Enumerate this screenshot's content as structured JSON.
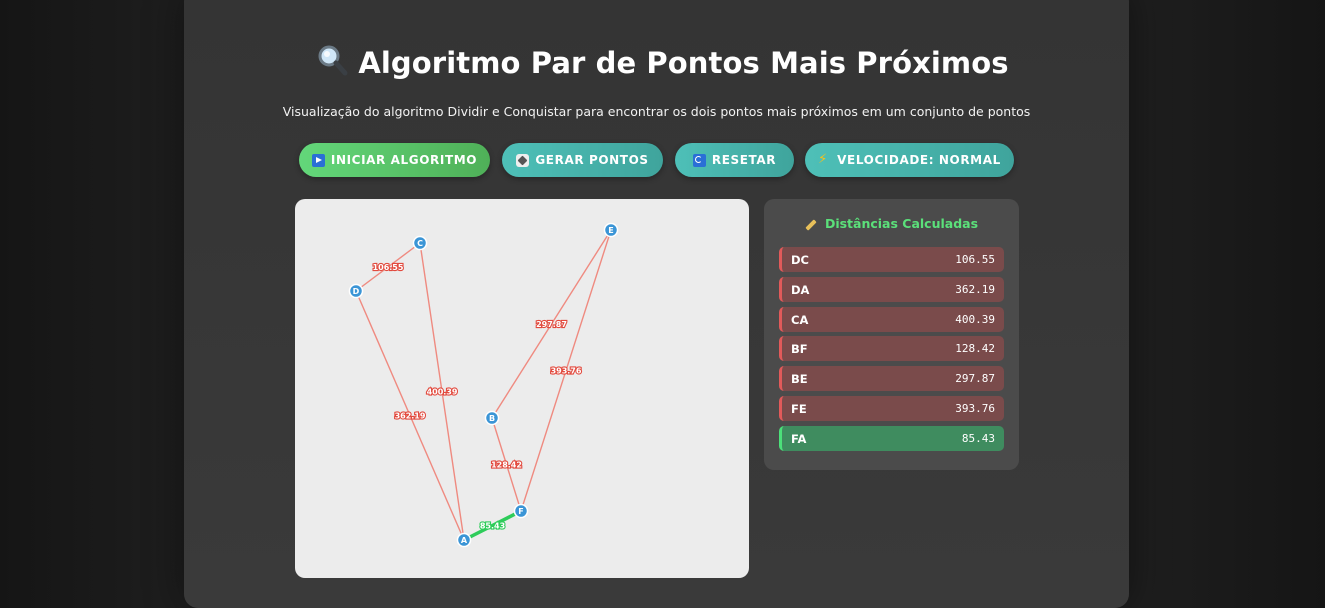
{
  "header": {
    "title": "Algoritmo Par de Pontos Mais Próximos",
    "subtitle": "Visualização do algoritmo Dividir e Conquistar para encontrar os dois pontos mais próximos em um conjunto de pontos"
  },
  "toolbar": {
    "start_label": "INICIAR ALGORITMO",
    "generate_label": "GERAR PONTOS",
    "reset_label": "RESETAR",
    "speed_label": "VELOCIDADE: NORMAL"
  },
  "canvas": {
    "points": [
      {
        "label": "A"
      },
      {
        "label": "B"
      },
      {
        "label": "C"
      },
      {
        "label": "D"
      },
      {
        "label": "E"
      },
      {
        "label": "F"
      }
    ],
    "edges": [
      {
        "from": "D",
        "to": "C",
        "label": "106.55",
        "best": false
      },
      {
        "from": "D",
        "to": "A",
        "label": "362.19",
        "best": false
      },
      {
        "from": "C",
        "to": "A",
        "label": "400.39",
        "best": false
      },
      {
        "from": "B",
        "to": "F",
        "label": "128.42",
        "best": false
      },
      {
        "from": "B",
        "to": "E",
        "label": "297.87",
        "best": false
      },
      {
        "from": "F",
        "to": "E",
        "label": "393.76",
        "best": false
      },
      {
        "from": "F",
        "to": "A",
        "label": "85.43",
        "best": true
      }
    ]
  },
  "sidebar": {
    "title": "Distâncias Calculadas",
    "rows": [
      {
        "name": "DC",
        "value": "106.55",
        "best": false
      },
      {
        "name": "DA",
        "value": "362.19",
        "best": false
      },
      {
        "name": "CA",
        "value": "400.39",
        "best": false
      },
      {
        "name": "BF",
        "value": "128.42",
        "best": false
      },
      {
        "name": "BE",
        "value": "297.87",
        "best": false
      },
      {
        "name": "FE",
        "value": "393.76",
        "best": false
      },
      {
        "name": "FA",
        "value": "85.43",
        "best": true
      }
    ]
  },
  "colors": {
    "edge": "#ef8a80",
    "best_edge": "#2ecc5a",
    "point": "#3b95d6",
    "edge_label": "#e24a3e"
  }
}
